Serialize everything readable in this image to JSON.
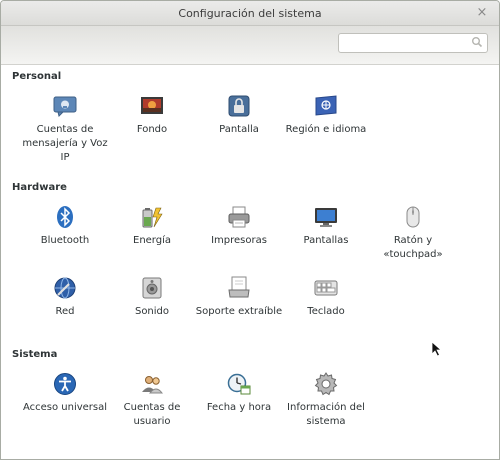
{
  "window": {
    "title": "Configuración del sistema",
    "close_glyph": "×"
  },
  "search": {
    "value": "",
    "placeholder": ""
  },
  "sections": [
    {
      "title": "Personal",
      "items": [
        {
          "label": "Cuentas de mensajería y Voz IP",
          "icon": "messaging-icon"
        },
        {
          "label": "Fondo",
          "icon": "background-icon"
        },
        {
          "label": "Pantalla",
          "icon": "screen-lock-icon"
        },
        {
          "label": "Región e idioma",
          "icon": "region-flag-icon"
        }
      ]
    },
    {
      "title": "Hardware",
      "items": [
        {
          "label": "Bluetooth",
          "icon": "bluetooth-icon"
        },
        {
          "label": "Energía",
          "icon": "battery-icon"
        },
        {
          "label": "Impresoras",
          "icon": "printer-icon"
        },
        {
          "label": "Pantallas",
          "icon": "monitor-icon"
        },
        {
          "label": "Ratón y «touchpad»",
          "icon": "mouse-icon"
        },
        {
          "label": "Red",
          "icon": "network-globe-icon"
        },
        {
          "label": "Sonido",
          "icon": "speaker-icon"
        },
        {
          "label": "Soporte extraíble",
          "icon": "removable-media-icon"
        },
        {
          "label": "Teclado",
          "icon": "keyboard-icon"
        }
      ]
    },
    {
      "title": "Sistema",
      "items": [
        {
          "label": "Acceso universal",
          "icon": "universal-access-icon"
        },
        {
          "label": "Cuentas de usuario",
          "icon": "user-accounts-icon"
        },
        {
          "label": "Fecha y hora",
          "icon": "clock-icon"
        },
        {
          "label": "Información del sistema",
          "icon": "gear-icon"
        }
      ]
    }
  ]
}
